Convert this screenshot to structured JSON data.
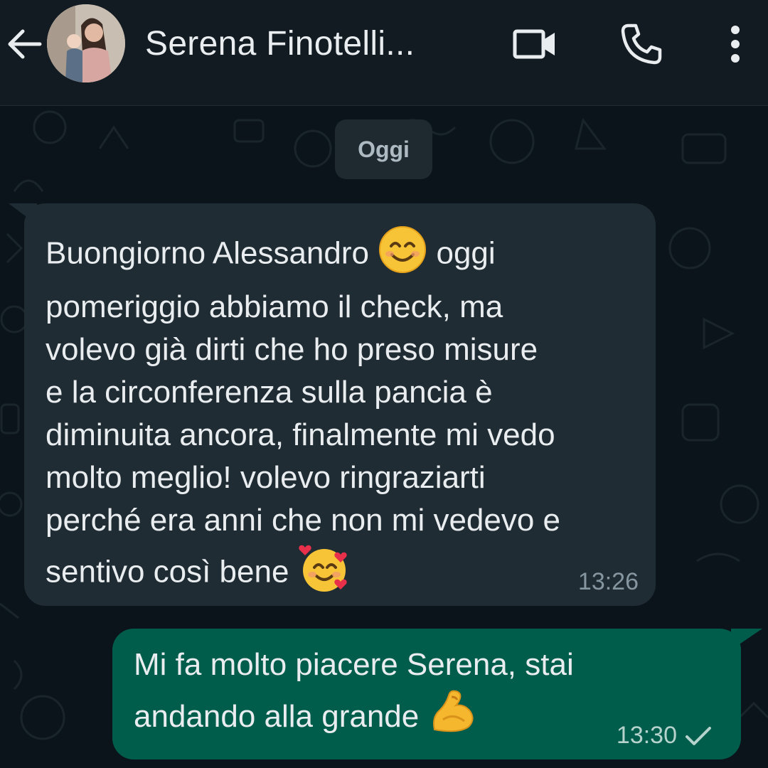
{
  "header": {
    "contact_name": "Serena Finotelli...",
    "back_icon": "arrow-left-icon",
    "video_icon": "video-call-icon",
    "call_icon": "phone-icon",
    "menu_icon": "more-vert-icon"
  },
  "chat": {
    "date_label": "Oggi",
    "incoming": {
      "lines": [
        "Buongiorno Alessandro",
        "oggi",
        "pomeriggio abbiamo il check, ma",
        "volevo già dirti che ho preso misure",
        "e la circonferenza sulla pancia è",
        "diminuita ancora, finalmente mi vedo",
        "molto meglio! volevo ringraziarti",
        "perché era anni che non mi vedevo e",
        "sentivo così bene"
      ],
      "emoji_1": "smiling-face-with-smiling-eyes",
      "emoji_2": "smiling-face-with-hearts",
      "time": "13:26"
    },
    "outgoing": {
      "lines": [
        "Mi fa molto piacere Serena, stai",
        "andando alla grande"
      ],
      "emoji": "flexed-biceps",
      "time": "13:30",
      "status_icon": "single-check-icon"
    }
  },
  "colors": {
    "header_bg": "#111b21",
    "chat_bg": "#0b141a",
    "incoming_bubble": "#1f2c33",
    "outgoing_bubble": "#005c4b",
    "text": "#e9edef",
    "meta_text": "#8696a0"
  }
}
